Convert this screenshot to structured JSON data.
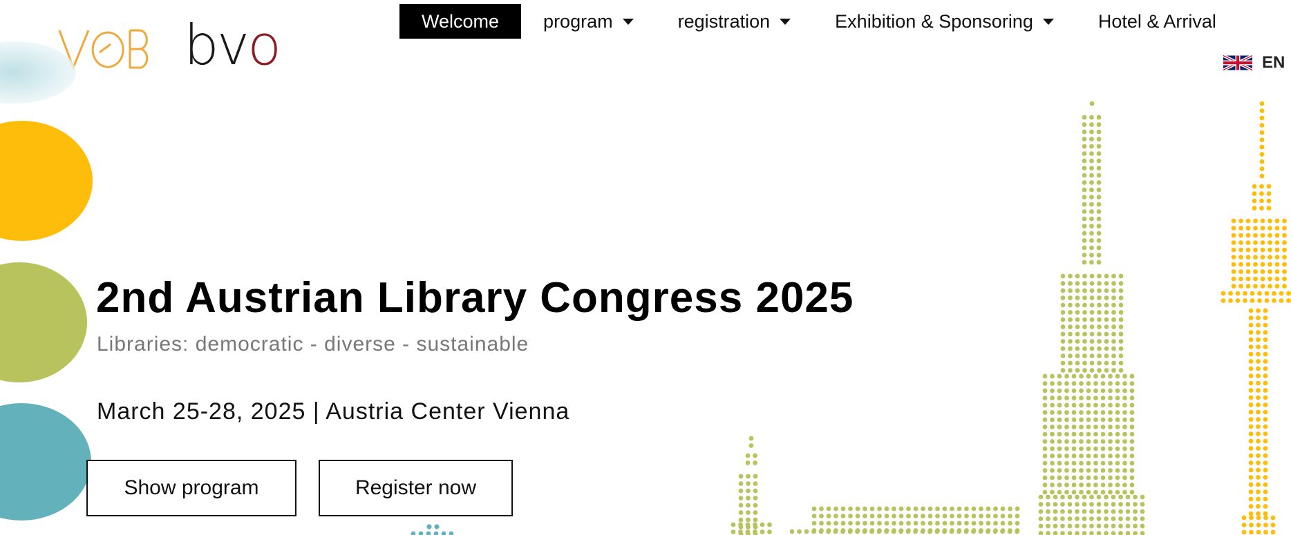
{
  "logos": {
    "voeb": "VÖB",
    "bvo_b": "b",
    "bvo_v": "v",
    "bvo_o": "o"
  },
  "nav": {
    "items": [
      {
        "label": "Welcome",
        "active": true,
        "dropdown": false
      },
      {
        "label": "program",
        "active": false,
        "dropdown": true
      },
      {
        "label": "registration",
        "active": false,
        "dropdown": true
      },
      {
        "label": "Exhibition & Sponsoring",
        "active": false,
        "dropdown": true
      },
      {
        "label": "Hotel & Arrival",
        "active": false,
        "dropdown": false
      }
    ],
    "language": "EN"
  },
  "hero": {
    "title": "2nd Austrian Library Congress 2025",
    "subtitle": "Libraries: democratic - diverse - sustainable",
    "date": "March 25-28, 2025 | Austria Center Vienna",
    "btn_program": "Show program",
    "btn_register": "Register now"
  },
  "colors": {
    "yellow": "#fdbd0a",
    "green": "#b9c35d",
    "teal": "#63b2bb",
    "logo_orange": "#f0a83a",
    "logo_red": "#8b1d23"
  },
  "icons": {
    "flag": "uk-flag-icon",
    "caret": "caret-down-icon"
  }
}
